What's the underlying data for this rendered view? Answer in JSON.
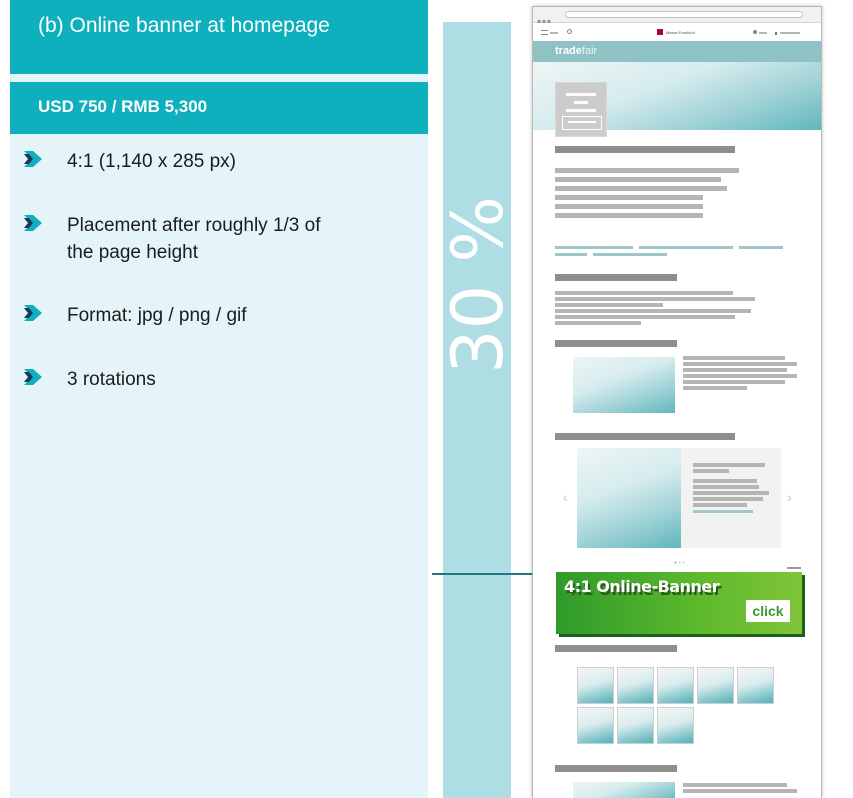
{
  "panel": {
    "title": "(b) Online banner at homepage",
    "price": "USD 750 / RMB 5,300",
    "bullets": [
      {
        "line1": "4:1 (1,140 x 285 px)",
        "line2": ""
      },
      {
        "line1": "Placement after roughly 1/3 of",
        "line2": "the page height"
      },
      {
        "line1": "Format: jpg / png / gif",
        "line2": ""
      },
      {
        "line1": "3 rotations",
        "line2": ""
      }
    ]
  },
  "band": {
    "label": "30 %"
  },
  "mockup": {
    "site_name_bold": "trade",
    "site_name_light": "fair",
    "logo_text": "Messe Frankfurt",
    "banner_label": "4:1 Online-Banner",
    "banner_button": "click"
  },
  "colors": {
    "accent": "#0fb0be",
    "panel_bg": "#e4f4f8",
    "band": "#aeddE4",
    "banner_green": "#5fba2c"
  }
}
